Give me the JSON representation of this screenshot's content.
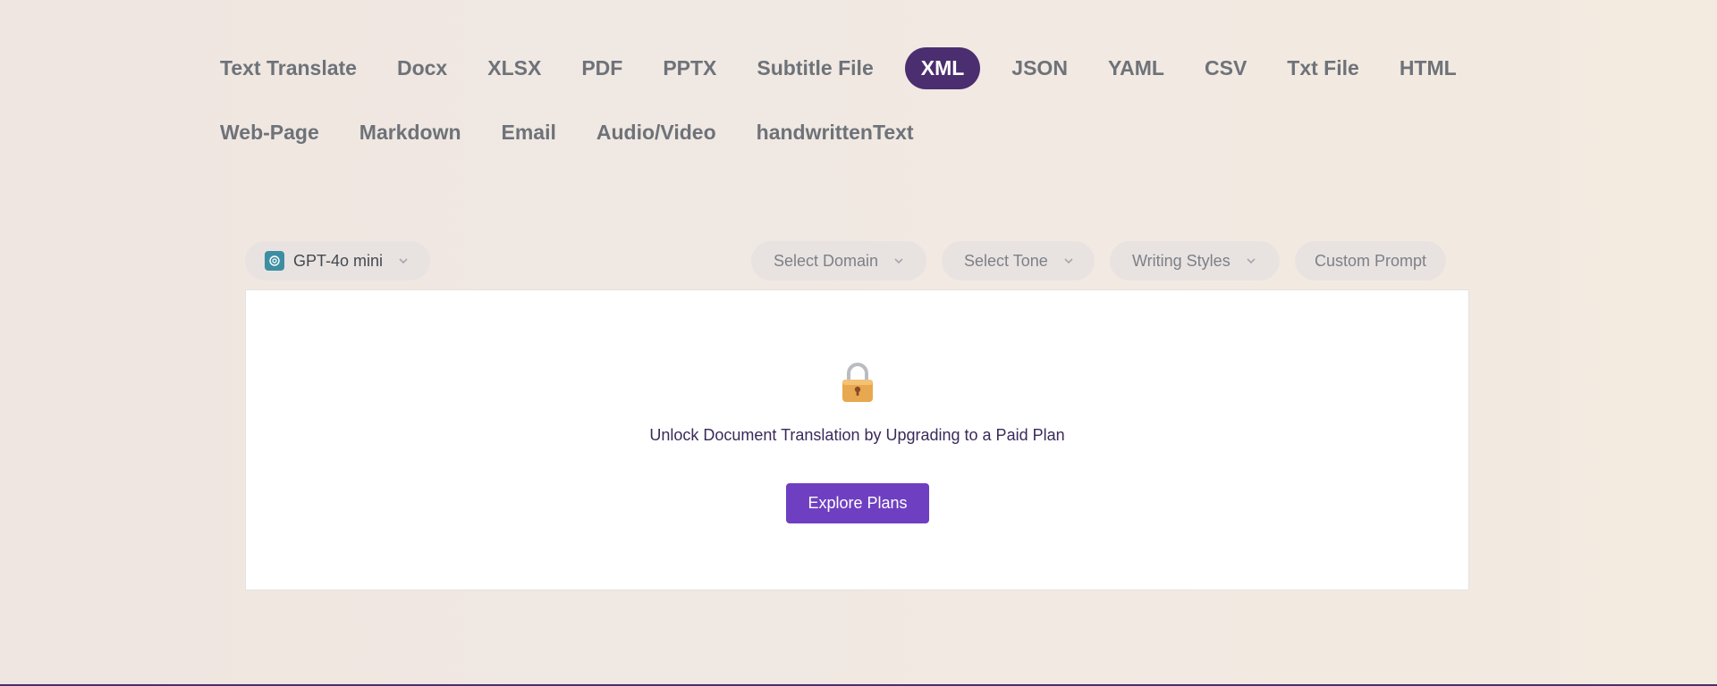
{
  "tabs": {
    "row1": [
      {
        "label": "Text Translate"
      },
      {
        "label": "Docx"
      },
      {
        "label": "XLSX"
      },
      {
        "label": "PDF"
      },
      {
        "label": "PPTX"
      },
      {
        "label": "Subtitle File"
      },
      {
        "label": "XML",
        "active": true
      },
      {
        "label": "JSON"
      },
      {
        "label": "YAML"
      },
      {
        "label": "CSV"
      },
      {
        "label": "Txt File"
      },
      {
        "label": "HTML"
      }
    ],
    "row2": [
      {
        "label": "Web-Page"
      },
      {
        "label": "Markdown"
      },
      {
        "label": "Email"
      },
      {
        "label": "Audio/Video"
      },
      {
        "label": "handwrittenText"
      }
    ],
    "active_color": "#4b2e6f"
  },
  "toolbar": {
    "model": {
      "label": "GPT-4o mini",
      "icon": "openai-icon",
      "icon_color": "#3d8ea2"
    },
    "domain": {
      "label": "Select Domain"
    },
    "tone": {
      "label": "Select Tone"
    },
    "styles": {
      "label": "Writing Styles"
    },
    "prompt": {
      "label": "Custom Prompt"
    }
  },
  "card": {
    "icon": "lock-icon",
    "message": "Unlock Document Translation by Upgrading to a Paid Plan",
    "button_label": "Explore Plans",
    "button_color": "#6e3fc1"
  }
}
